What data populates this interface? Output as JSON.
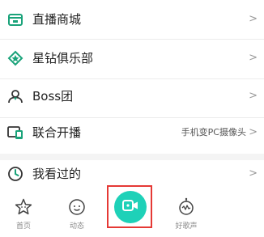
{
  "menu": {
    "items": [
      {
        "label": "直播商城",
        "hint": "",
        "chevron": ">",
        "icon": "shop-icon"
      },
      {
        "label": "星钻俱乐部",
        "hint": "",
        "chevron": ">",
        "icon": "diamond-club-icon"
      },
      {
        "label": "Boss团",
        "hint": "",
        "chevron": ">",
        "icon": "boss-group-icon"
      },
      {
        "label": "联合开播",
        "hint": "手机变PC摄像头",
        "chevron": ">",
        "icon": "co-stream-icon"
      },
      {
        "label": "我看过的",
        "hint": "",
        "chevron": ">",
        "icon": "history-clock-icon"
      }
    ]
  },
  "tabbar": {
    "tabs": [
      {
        "label": "首页",
        "icon": "home-star-icon"
      },
      {
        "label": "动态",
        "icon": "feed-face-icon"
      },
      {
        "label": "",
        "icon": "live-camera-icon"
      },
      {
        "label": "好歌声",
        "icon": "robot-singer-icon"
      }
    ]
  },
  "colors": {
    "accent_green": "#1aa37a",
    "live_button": "#1ed1b8",
    "highlight_border": "#e53935"
  }
}
